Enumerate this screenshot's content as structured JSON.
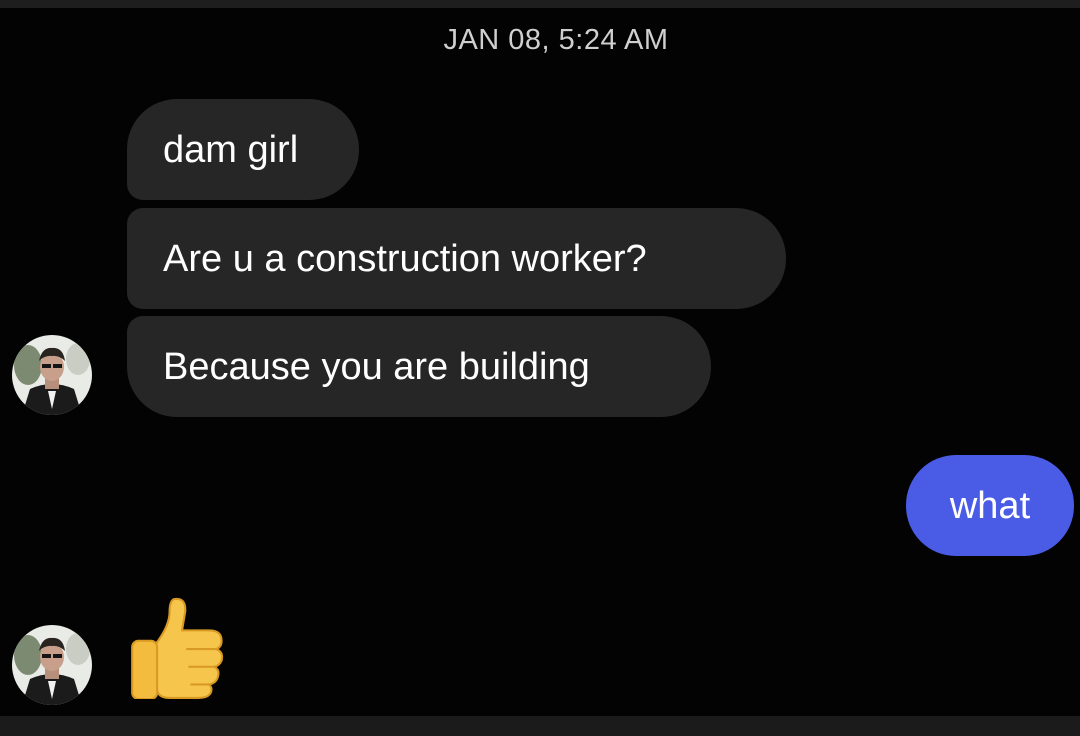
{
  "conversation": {
    "timestamp": "JAN 08, 5:24 AM",
    "received_messages": [
      {
        "text": "dam girl"
      },
      {
        "text": "Are u a construction worker?"
      },
      {
        "text": "Because you are building"
      }
    ],
    "sent_messages": [
      {
        "text": "what"
      }
    ],
    "reaction": {
      "type": "emoji",
      "name": "thumbs-up-icon"
    }
  },
  "colors": {
    "background": "#030303",
    "received_bubble": "#262626",
    "sent_bubble": "#4a5be6",
    "text": "#ffffff",
    "timestamp": "#cfcfcf"
  }
}
